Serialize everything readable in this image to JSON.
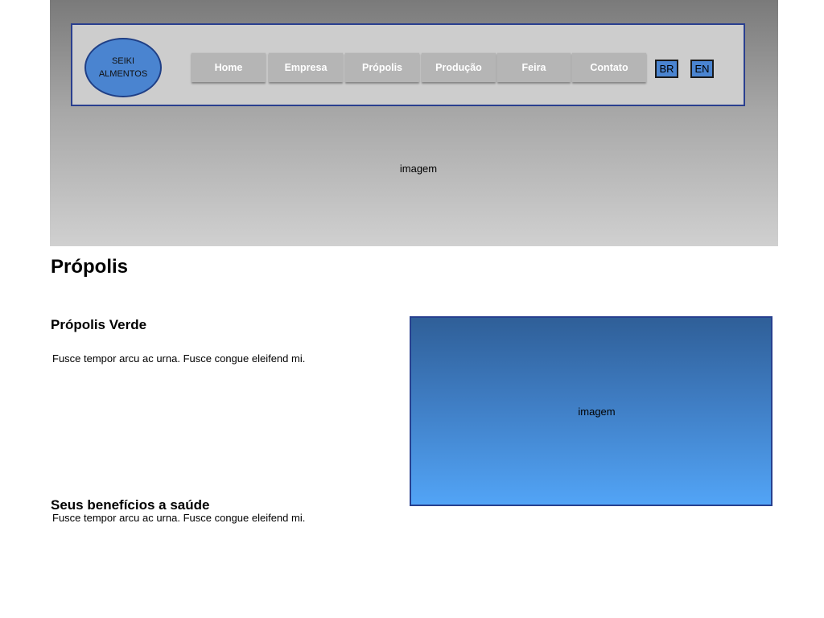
{
  "header": {
    "logo": {
      "line1": "SEIKI",
      "line2": "ALMENTOS"
    },
    "nav": [
      {
        "label": "Home"
      },
      {
        "label": "Empresa"
      },
      {
        "label": "Própolis"
      },
      {
        "label": "Produção"
      },
      {
        "label": "Feira"
      },
      {
        "label": "Contato"
      }
    ],
    "languages": [
      {
        "label": "BR"
      },
      {
        "label": "EN"
      }
    ]
  },
  "hero": {
    "image_label": "imagem"
  },
  "main": {
    "title": "Própolis",
    "sections": [
      {
        "heading": "Própolis Verde",
        "text": "Fusce tempor arcu ac urna. Fusce congue eleifend mi."
      },
      {
        "heading": "Seus benefícios a saúde",
        "text": "Fusce tempor arcu ac urna. Fusce congue eleifend mi."
      }
    ],
    "image_label": "imagem"
  },
  "colors": {
    "accent_blue": "#4a84d0",
    "border_blue": "#2a3f8f",
    "nav_button": "#b5b5b5",
    "header_bg": "#cdcdcd"
  }
}
